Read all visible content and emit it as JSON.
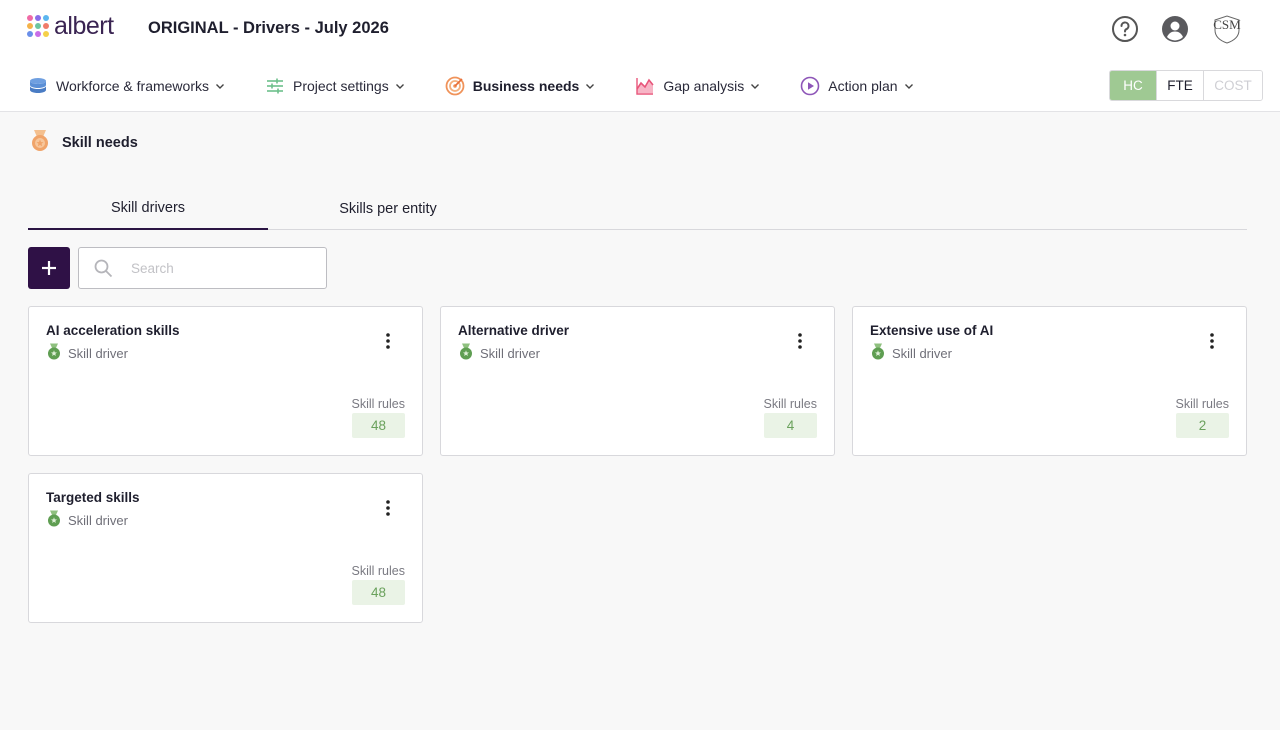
{
  "app": {
    "logo_text": "albert",
    "logo_dot_colors": [
      "#f06aa6",
      "#8a6de9",
      "#5bb6ef",
      "#f4b24a",
      "#6cc6a0",
      "#f07c6a",
      "#6a8fe9",
      "#c86ee8",
      "#f5d04a"
    ],
    "project_title": "ORIGINAL - Drivers - July 2026",
    "org_logo_text": "CSM"
  },
  "nav": {
    "items": [
      {
        "label": "Workforce & frameworks",
        "icon": "database-stack-icon",
        "color": "#5b8fd6"
      },
      {
        "label": "Project settings",
        "icon": "sliders-icon",
        "color": "#6cbf8a"
      },
      {
        "label": "Business needs",
        "icon": "target-icon",
        "color": "#f0935a",
        "active": true
      },
      {
        "label": "Gap analysis",
        "icon": "area-chart-icon",
        "color": "#e8557a"
      },
      {
        "label": "Action plan",
        "icon": "play-circle-icon",
        "color": "#8e56b8"
      }
    ]
  },
  "units": {
    "hc": "HC",
    "fte": "FTE",
    "cost": "COST",
    "active_color": "#9fc993"
  },
  "section": {
    "title": "Skill needs",
    "icon": "medal-icon"
  },
  "tabs": [
    {
      "label": "Skill drivers",
      "active": true
    },
    {
      "label": "Skills per entity",
      "active": false
    }
  ],
  "search": {
    "placeholder": "Search"
  },
  "cards": [
    {
      "title": "AI acceleration skills",
      "subtitle": "Skill driver",
      "rules_label": "Skill rules",
      "rules_count": "48"
    },
    {
      "title": "Alternative driver",
      "subtitle": "Skill driver",
      "rules_label": "Skill rules",
      "rules_count": "4"
    },
    {
      "title": "Extensive use of AI",
      "subtitle": "Skill driver",
      "rules_label": "Skill rules",
      "rules_count": "2"
    },
    {
      "title": "Targeted skills",
      "subtitle": "Skill driver",
      "rules_label": "Skill rules",
      "rules_count": "48"
    }
  ]
}
